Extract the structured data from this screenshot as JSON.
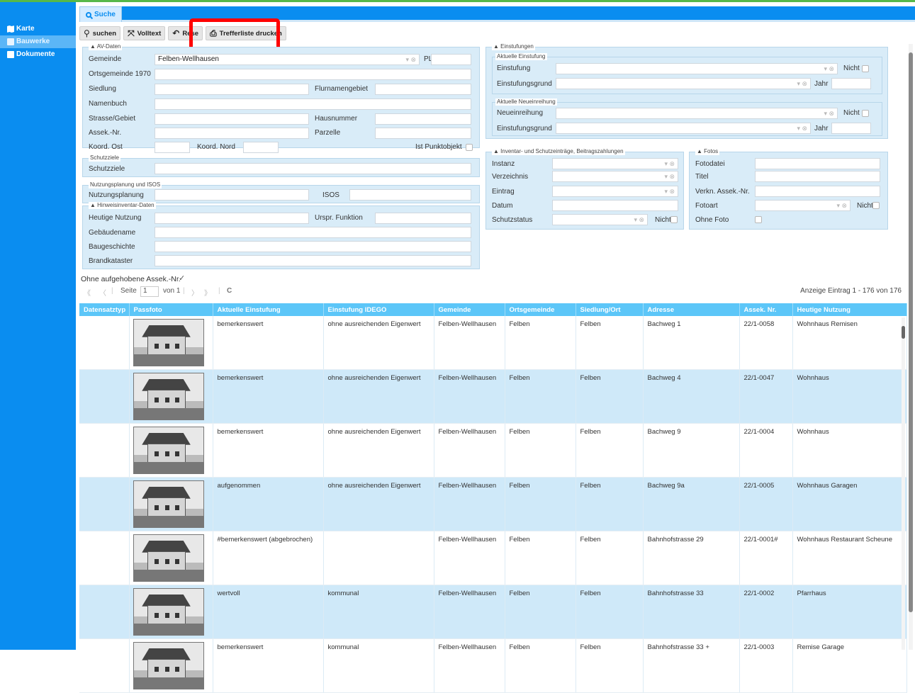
{
  "sidebar": {
    "items": [
      {
        "label": "Karte",
        "icon": "map-icon"
      },
      {
        "label": "Bauwerke",
        "icon": "building-icon"
      },
      {
        "label": "Dokumente",
        "icon": "document-icon"
      }
    ]
  },
  "tab": {
    "label": "Suche"
  },
  "toolbar": {
    "search_label": "suchen",
    "fulltext_label": "Volltext",
    "reset_label": "Rese",
    "print_label": "Trefferliste drucken"
  },
  "av": {
    "legend": "▲  AV-Daten",
    "gemeinde_label": "Gemeinde",
    "gemeinde_value": "Felben-Wellhausen",
    "plz_label": "PLZ",
    "ortsgemeinde_label": "Ortsgemeinde 1970",
    "siedlung_label": "Siedlung",
    "flurname_label": "Flurnamengebiet",
    "namenbuch_label": "Namenbuch",
    "strasse_label": "Strasse/Gebiet",
    "hausnummer_label": "Hausnummer",
    "assek_label": "Assek.-Nr.",
    "parzelle_label": "Parzelle",
    "koord_ost_label": "Koord. Ost",
    "koord_nord_label": "Koord. Nord",
    "punktobjekt_label": "Ist Punktobjekt"
  },
  "schutzziele": {
    "legend": "Schutzziele",
    "label": "Schutzziele"
  },
  "nutzung": {
    "legend": "Nutzungsplanung und ISOS",
    "label": "Nutzungsplanung",
    "isos_label": "ISOS"
  },
  "hinweis": {
    "legend": "▲  Hinweisinventar-Daten",
    "heutige_label": "Heutige Nutzung",
    "urspr_label": "Urspr. Funktion",
    "gebaeude_label": "Gebäudename",
    "baugeschichte_label": "Baugeschichte",
    "brandkataster_label": "Brandkataster"
  },
  "einstufungen": {
    "legend": "▲  Einstufungen",
    "aktuelle_legend": "Aktuelle Einstufung",
    "einstufung_label": "Einstufung",
    "nicht_label": "Nicht",
    "grund_label": "Einstufungsgrund",
    "jahr_label": "Jahr",
    "neu_legend": "Aktuelle Neueinreihung",
    "neueinreihung_label": "Neueinreihung",
    "grund2_label": "Einstufungsgrund",
    "nicht2_label": "Nicht",
    "jahr2_label": "Jahr"
  },
  "inventar": {
    "legend": "▲  Inventar- und Schutzeinträge, Beitragszahlungen",
    "instanz_label": "Instanz",
    "verzeichnis_label": "Verzeichnis",
    "eintrag_label": "Eintrag",
    "datum_label": "Datum",
    "schutzstatus_label": "Schutzstatus",
    "nicht_label": "Nicht"
  },
  "fotos": {
    "legend": "▲  Fotos",
    "fotodatei_label": "Fotodatei",
    "titel_label": "Titel",
    "verkn_label": "Verkn. Assek.-Nr.",
    "fotoart_label": "Fotoart",
    "nicht_label": "Nicht",
    "ohne_label": "Ohne Foto"
  },
  "filter": {
    "ohne_label": "Ohne aufgehobene Assek.-Nr.",
    "checkmark": "✓"
  },
  "pager": {
    "first": "《",
    "prev": "〈",
    "seite_label": "Seite",
    "page": "1",
    "von_label": "von 1",
    "next": "〉",
    "last": "》",
    "refresh": "C",
    "summary": "Anzeige Eintrag 1 - 176 von 176"
  },
  "grid": {
    "columns": [
      "Datensatztyp",
      "Passfoto",
      "Aktuelle Einstufung",
      "Einstufung IDEGO",
      "Gemeinde",
      "Ortsgemeinde",
      "Siedlung/Ort",
      "Adresse",
      "Assek. Nr.",
      "Heutige Nutzung"
    ],
    "rows": [
      {
        "typ": "",
        "einstufung": "bemerkenswert",
        "idego": "ohne ausreichenden Eigenwert",
        "gemeinde": "Felben-Wellhausen",
        "ortsgemeinde": "Felben",
        "siedlung": "Felben",
        "adresse": "Bachweg 1",
        "assek": "22/1-0058",
        "nutzung": "Wohnhaus Remisen"
      },
      {
        "typ": "",
        "einstufung": "bemerkenswert",
        "idego": "ohne ausreichenden Eigenwert",
        "gemeinde": "Felben-Wellhausen",
        "ortsgemeinde": "Felben",
        "siedlung": "Felben",
        "adresse": "Bachweg 4",
        "assek": "22/1-0047",
        "nutzung": "Wohnhaus"
      },
      {
        "typ": "",
        "einstufung": "bemerkenswert",
        "idego": "ohne ausreichenden Eigenwert",
        "gemeinde": "Felben-Wellhausen",
        "ortsgemeinde": "Felben",
        "siedlung": "Felben",
        "adresse": "Bachweg 9",
        "assek": "22/1-0004",
        "nutzung": "Wohnhaus"
      },
      {
        "typ": "",
        "einstufung": "aufgenommen",
        "idego": "ohne ausreichenden Eigenwert",
        "gemeinde": "Felben-Wellhausen",
        "ortsgemeinde": "Felben",
        "siedlung": "Felben",
        "adresse": "Bachweg 9a",
        "assek": "22/1-0005",
        "nutzung": "Wohnhaus Garagen"
      },
      {
        "typ": "",
        "einstufung": "#bemerkenswert (abgebrochen)",
        "idego": "",
        "gemeinde": "Felben-Wellhausen",
        "ortsgemeinde": "Felben",
        "siedlung": "Felben",
        "adresse": "Bahnhofstrasse 29",
        "assek": "22/1-0001#",
        "nutzung": "Wohnhaus Restaurant Scheune"
      },
      {
        "typ": "",
        "einstufung": "wertvoll",
        "idego": "kommunal",
        "gemeinde": "Felben-Wellhausen",
        "ortsgemeinde": "Felben",
        "siedlung": "Felben",
        "adresse": "Bahnhofstrasse 33",
        "assek": "22/1-0002",
        "nutzung": "Pfarrhaus"
      },
      {
        "typ": "",
        "einstufung": "bemerkenswert",
        "idego": "kommunal",
        "gemeinde": "Felben-Wellhausen",
        "ortsgemeinde": "Felben",
        "siedlung": "Felben",
        "adresse": "Bahnhofstrasse 33 +",
        "assek": "22/1-0003",
        "nutzung": "Remise Garage"
      }
    ]
  }
}
